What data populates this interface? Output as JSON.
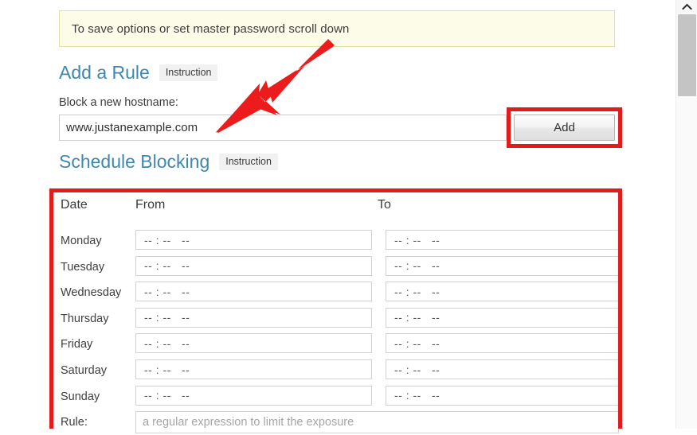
{
  "notice": {
    "text": "To save options or set master password scroll down"
  },
  "add_rule": {
    "heading": "Add a Rule",
    "badge": "Instruction",
    "field_label": "Block a new hostname:",
    "hostname_value": "www.justanexample.com",
    "add_button": "Add"
  },
  "schedule": {
    "heading": "Schedule Blocking",
    "badge": "Instruction",
    "columns": {
      "date": "Date",
      "from": "From",
      "to": "To"
    },
    "rows": [
      {
        "day": "Monday",
        "from": "-- : --   --",
        "to": "-- : --   --"
      },
      {
        "day": "Tuesday",
        "from": "-- : --   --",
        "to": "-- : --   --"
      },
      {
        "day": "Wednesday",
        "from": "-- : --   --",
        "to": "-- : --   --"
      },
      {
        "day": "Thursday",
        "from": "-- : --   --",
        "to": "-- : --   --"
      },
      {
        "day": "Friday",
        "from": "-- : --   --",
        "to": "-- : --   --"
      },
      {
        "day": "Saturday",
        "from": "-- : --   --",
        "to": "-- : --   --"
      },
      {
        "day": "Sunday",
        "from": "-- : --   --",
        "to": "-- : --   --"
      }
    ],
    "rule": {
      "label": "Rule:",
      "placeholder": "a regular expression to limit the exposure"
    }
  },
  "annotations": {
    "arrow_color": "#ec1c1c",
    "highlight_color": "#e21b1b",
    "arrow_name": "red-pointer-arrow"
  },
  "colors": {
    "heading": "#3e88b0",
    "notice_bg": "#fcfce8",
    "notice_border": "#e3dfa6"
  },
  "scrollbar": {
    "up_arrow": "⌃"
  }
}
